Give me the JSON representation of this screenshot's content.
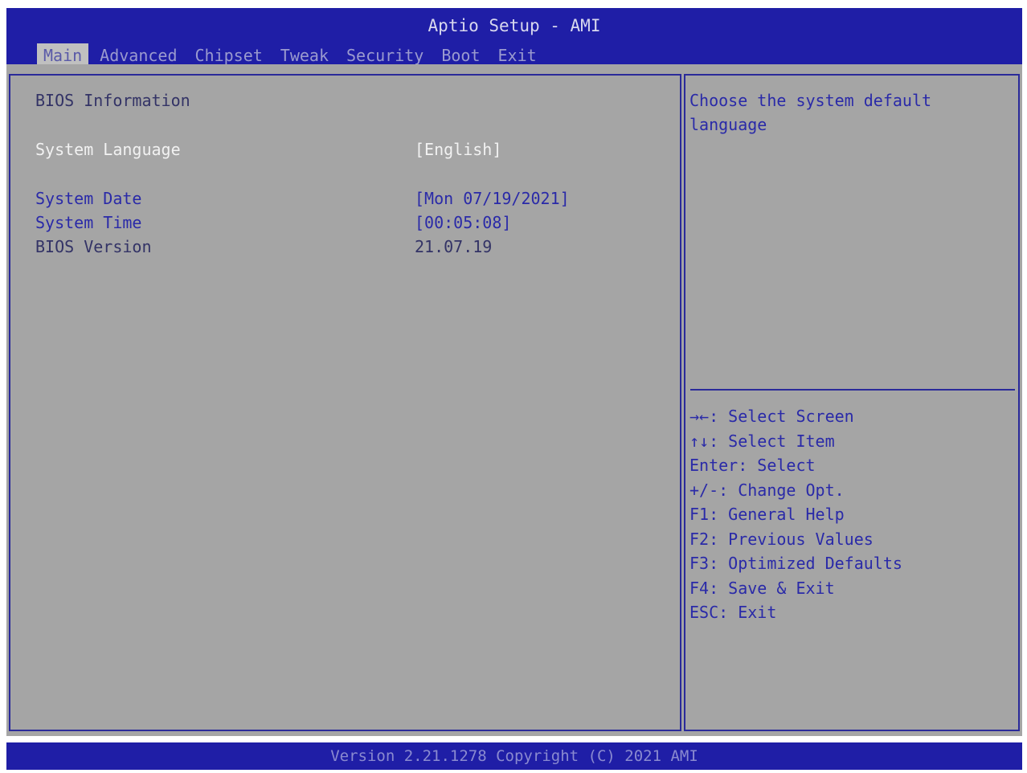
{
  "header": {
    "title": "Aptio Setup - AMI",
    "tabs": [
      {
        "label": "Main",
        "active": true
      },
      {
        "label": "Advanced",
        "active": false
      },
      {
        "label": "Chipset",
        "active": false
      },
      {
        "label": "Tweak",
        "active": false
      },
      {
        "label": "Security",
        "active": false
      },
      {
        "label": "Boot",
        "active": false
      },
      {
        "label": "Exit",
        "active": false
      }
    ]
  },
  "main": {
    "section_title": "BIOS Information",
    "system_language": {
      "label": "System Language",
      "value": "[English]"
    },
    "system_date": {
      "label": "System Date",
      "value": "[Mon 07/19/2021]"
    },
    "system_time": {
      "label": "System Time",
      "value": "[00:05:08]"
    },
    "bios_version": {
      "label": "BIOS Version",
      "value": "21.07.19"
    }
  },
  "help": {
    "description": "Choose the system default language",
    "keys": [
      "→←: Select Screen",
      "↑↓: Select Item",
      "Enter: Select",
      "+/-: Change Opt.",
      "F1: General Help",
      "F2: Previous Values",
      "F3: Optimized Defaults",
      "F4: Save & Exit",
      "ESC: Exit"
    ]
  },
  "footer": {
    "text": "Version 2.21.1278 Copyright (C) 2021 AMI"
  },
  "colors": {
    "header_bg": "#1f1ea6",
    "panel_bg": "#a5a5a5",
    "text_blue": "#2a2aa8",
    "text_selected": "#f2f2f2"
  }
}
